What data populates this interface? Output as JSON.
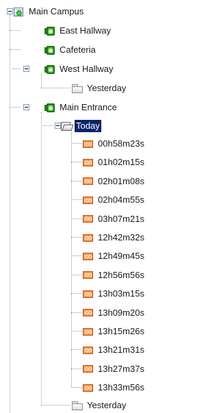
{
  "tree": {
    "root": {
      "label": "Main Campus",
      "icon": "campus-icon"
    },
    "cameras": [
      {
        "label": "East Hallway",
        "icon": "camera-icon"
      },
      {
        "label": "Cafeteria",
        "icon": "camera-icon"
      },
      {
        "label": "West Hallway",
        "icon": "camera-icon",
        "children": [
          {
            "label": "Yesterday",
            "icon": "folder-icon"
          }
        ]
      },
      {
        "label": "Main Entrance",
        "icon": "camera-icon",
        "children": [
          {
            "label": "Today",
            "icon": "folder-open-icon",
            "selected": true,
            "clips": [
              "00h58m23s",
              "01h02m15s",
              "02h01m08s",
              "02h04m55s",
              "03h07m21s",
              "12h42m32s",
              "12h49m45s",
              "12h56m56s",
              "13h03m15s",
              "13h09m20s",
              "13h15m26s",
              "13h21m31s",
              "13h27m37s",
              "13h33m56s"
            ]
          },
          {
            "label": "Yesterday",
            "icon": "folder-icon"
          }
        ]
      }
    ]
  },
  "colors": {
    "selection": "#0a246a",
    "clip_icon": "#ff9a4a",
    "camera_icon": "#2d9c1c"
  }
}
